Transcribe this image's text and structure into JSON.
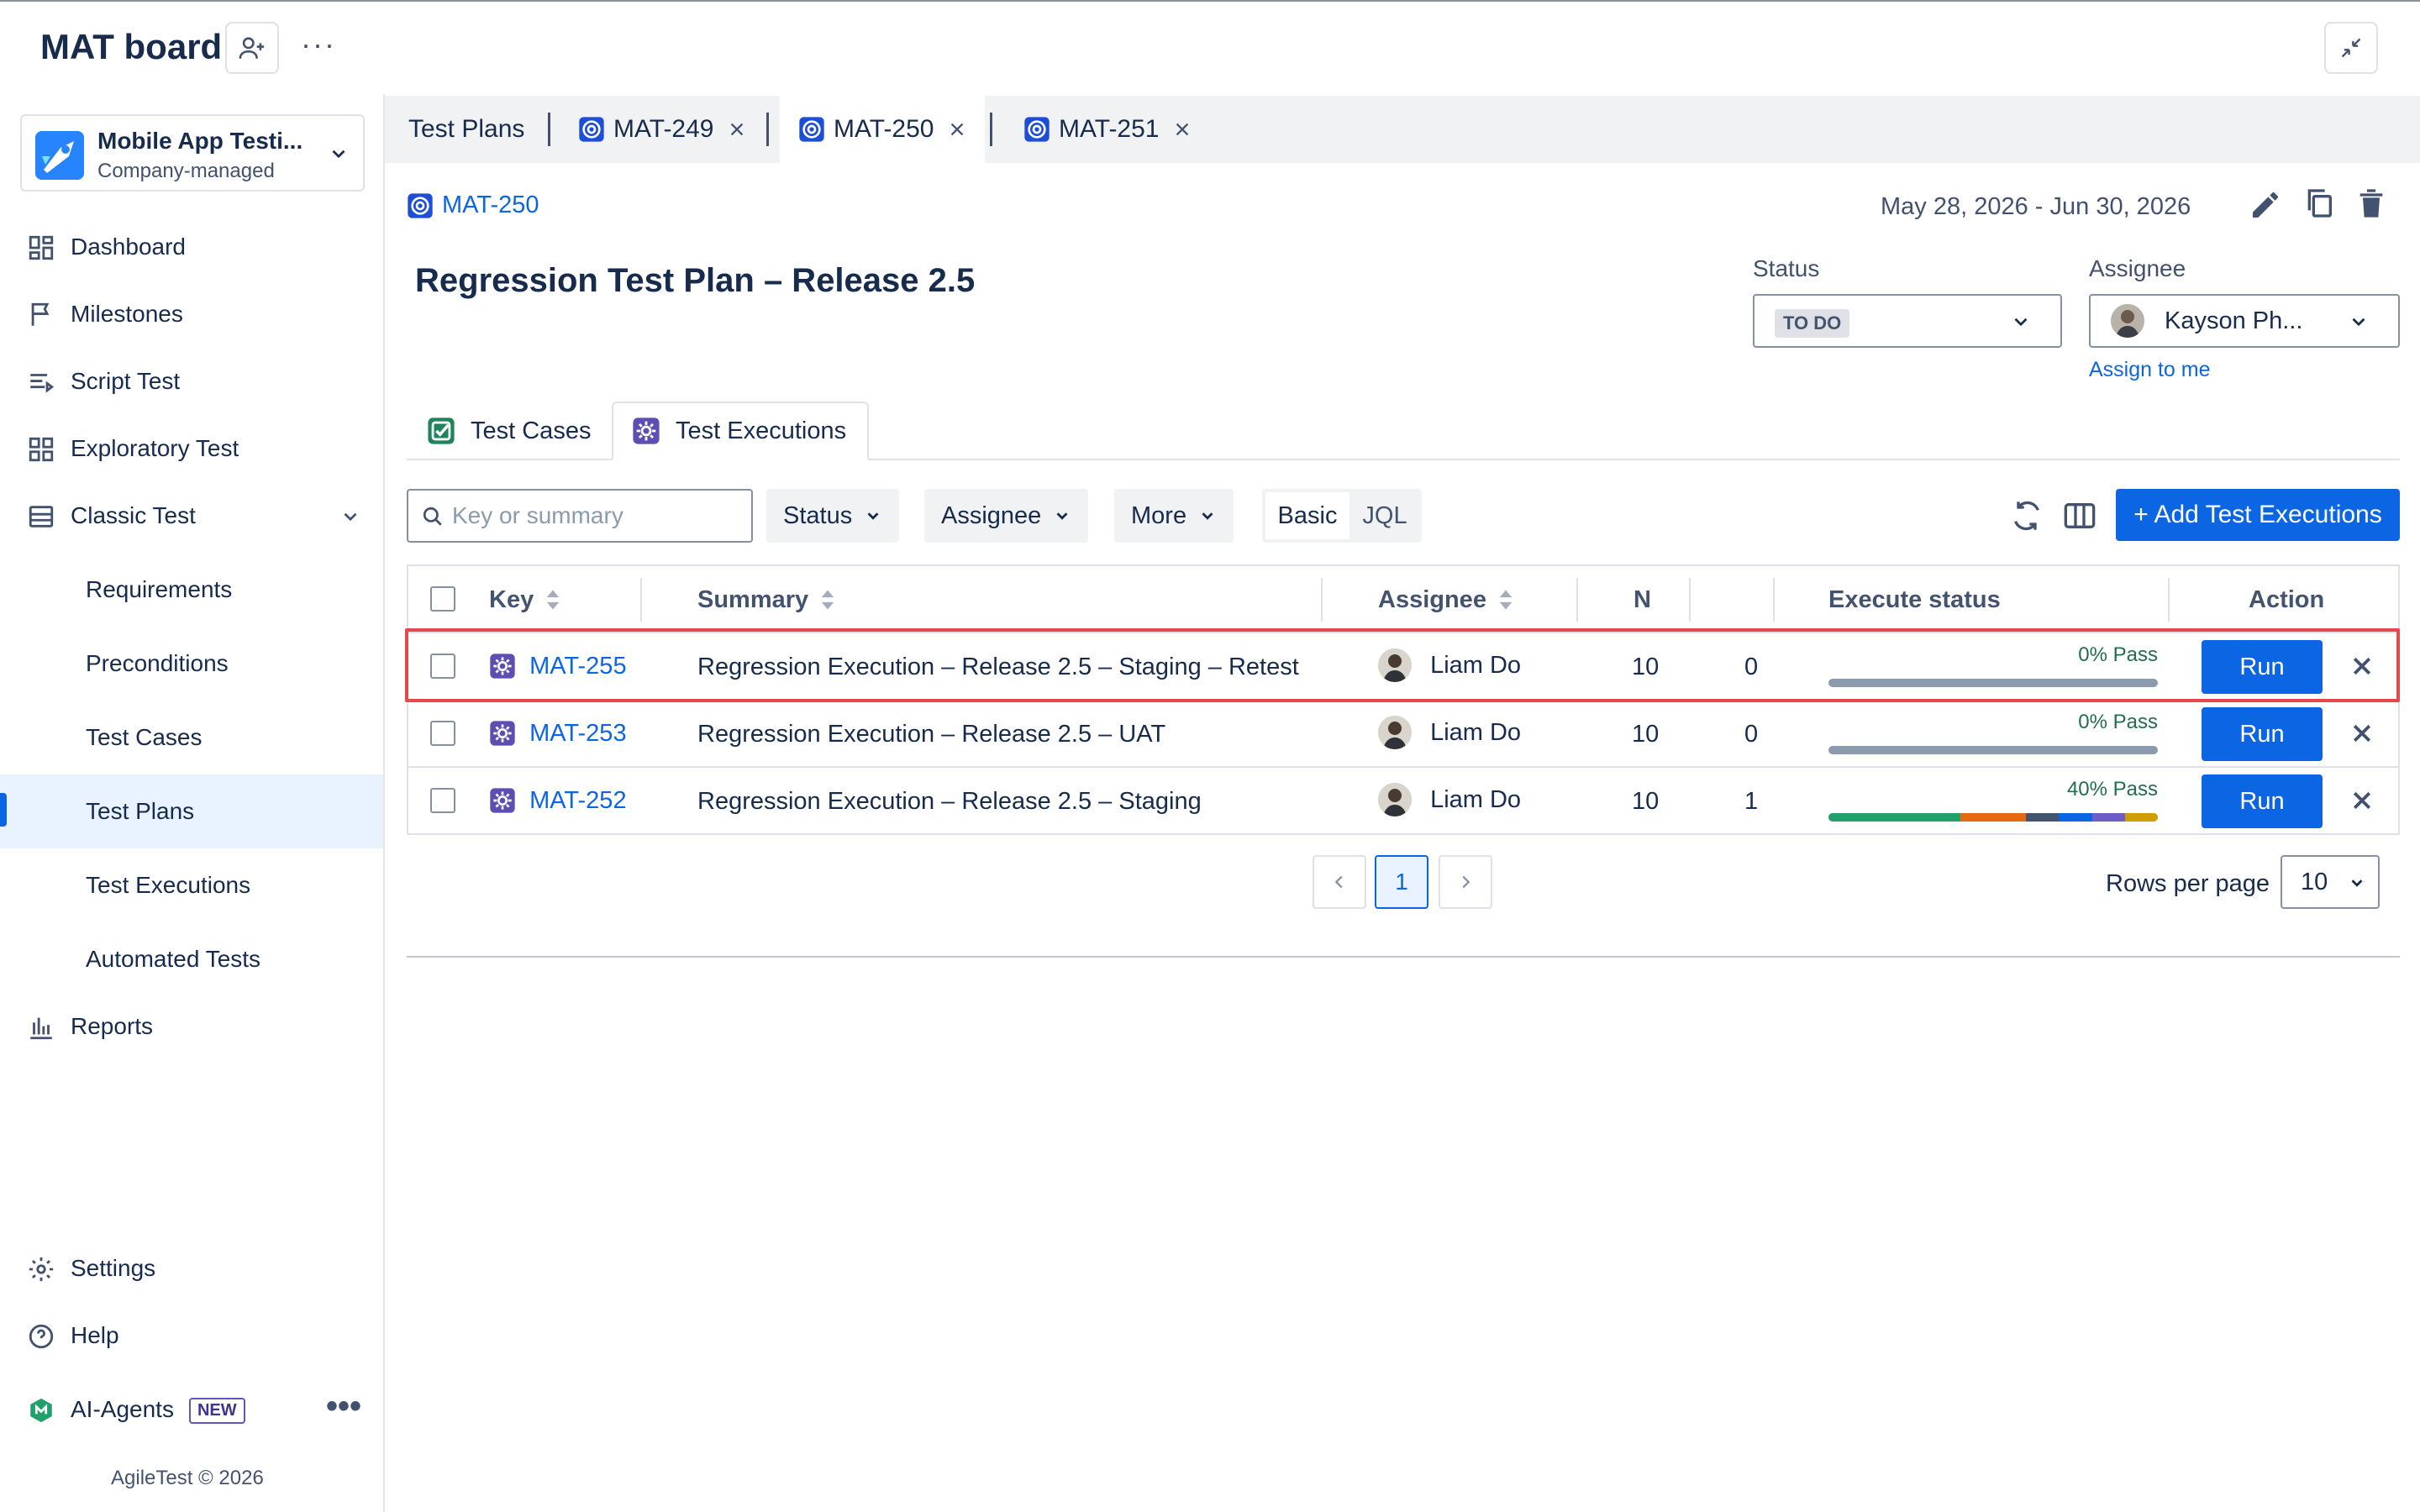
{
  "header": {
    "board_title": "MAT board"
  },
  "project": {
    "name": "Mobile App Testi...",
    "type": "Company-managed"
  },
  "sidebar": {
    "items": [
      {
        "label": "Dashboard"
      },
      {
        "label": "Milestones"
      },
      {
        "label": "Script Test"
      },
      {
        "label": "Exploratory Test"
      },
      {
        "label": "Classic Test"
      }
    ],
    "sub_items": [
      {
        "label": "Requirements"
      },
      {
        "label": "Preconditions"
      },
      {
        "label": "Test Cases"
      },
      {
        "label": "Test Plans",
        "active": true
      },
      {
        "label": "Test Executions"
      },
      {
        "label": "Automated Tests"
      }
    ],
    "reports": "Reports",
    "settings": "Settings",
    "help": "Help",
    "ai_agents": "AI-Agents",
    "new_badge": "NEW",
    "footer": "AgileTest © 2026"
  },
  "tabs": [
    {
      "label": "Test Plans"
    },
    {
      "label": "MAT-249"
    },
    {
      "label": "MAT-250",
      "active": true
    },
    {
      "label": "MAT-251"
    }
  ],
  "plan": {
    "key": "MAT-250",
    "date_range": "May 28, 2026 - Jun 30, 2026",
    "title": "Regression Test Plan – Release 2.5",
    "status_label": "Status",
    "status_value": "TO DO",
    "assignee_label": "Assignee",
    "assignee_value": "Kayson Ph...",
    "assign_to_me": "Assign to me"
  },
  "content_tabs": [
    {
      "label": "Test Cases"
    },
    {
      "label": "Test Executions",
      "active": true
    }
  ],
  "toolbar": {
    "search_placeholder": "Key or summary",
    "status_filter": "Status",
    "assignee_filter": "Assignee",
    "more_filter": "More",
    "basic": "Basic",
    "jql": "JQL",
    "add_button": "+ Add Test Executions"
  },
  "table": {
    "columns": [
      "Key",
      "Summary",
      "Assignee",
      "N",
      "",
      "Execute status",
      "Action"
    ],
    "rows": [
      {
        "key": "MAT-255",
        "summary": "Regression Execution – Release 2.5 – Staging – Retest",
        "assignee": "Liam Do",
        "n": "10",
        "count": "0",
        "pass": "0% Pass",
        "action": "Run",
        "highlighted": true,
        "segments": []
      },
      {
        "key": "MAT-253",
        "summary": "Regression Execution – Release 2.5 – UAT",
        "assignee": "Liam Do",
        "n": "10",
        "count": "0",
        "pass": "0% Pass",
        "action": "Run",
        "segments": []
      },
      {
        "key": "MAT-252",
        "summary": "Regression Execution – Release 2.5 – Staging",
        "assignee": "Liam Do",
        "n": "10",
        "count": "1",
        "pass": "40% Pass",
        "action": "Run",
        "segments": [
          {
            "fraction": 0.4,
            "color": "#22a06b"
          },
          {
            "fraction": 0.2,
            "color": "#e56910"
          },
          {
            "fraction": 0.1,
            "color": "#44546f"
          },
          {
            "fraction": 0.1,
            "color": "#0c66e4"
          },
          {
            "fraction": 0.1,
            "color": "#6e5dc6"
          },
          {
            "fraction": 0.1,
            "color": "#cf9f02"
          }
        ]
      }
    ]
  },
  "pagination": {
    "current_page": "1",
    "rows_per_page_label": "Rows per page",
    "rows_per_page": "10"
  },
  "colors": {
    "primary": "#0c66e4",
    "highlight": "#e5484d",
    "pass_text": "#216e4e"
  }
}
